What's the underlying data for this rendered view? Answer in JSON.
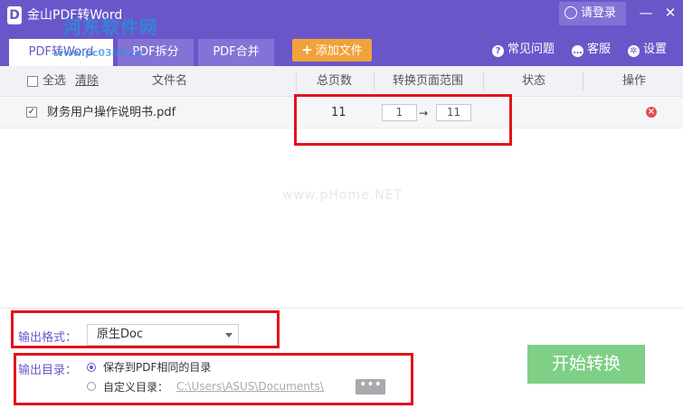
{
  "window": {
    "logo_letter": "D",
    "title": "金山PDF转Word",
    "login_label": "请登录",
    "minimize_glyph": "—",
    "close_glyph": "✕"
  },
  "watermark": {
    "brand": "河东软件网",
    "url": "www.pc0359.cn",
    "center": "www.pHome.NET"
  },
  "tabs": [
    {
      "label": "PDF转Word",
      "active": true
    },
    {
      "label": "PDF拆分",
      "active": false
    },
    {
      "label": "PDF合并",
      "active": false
    }
  ],
  "toolbar": {
    "add_file_label": "添加文件",
    "faq_label": "常见问题",
    "service_label": "客服",
    "settings_label": "设置"
  },
  "table": {
    "select_all_label": "全选",
    "clear_label": "清除",
    "columns": [
      "文件名",
      "总页数",
      "转换页面范围",
      "状态",
      "操作"
    ],
    "rows": [
      {
        "checked": true,
        "filename": "财务用户操作说明书.pdf",
        "total_pages": "11",
        "range_from": "1",
        "range_to": "11",
        "arrow": "→",
        "status": ""
      }
    ]
  },
  "output": {
    "format_label": "输出格式：",
    "format_value": "原生Doc",
    "dir_label": "输出目录：",
    "option_same": "保存到PDF相同的目录",
    "option_custom": "自定义目录：",
    "custom_path": "C:\\Users\\ASUS\\Documents\\",
    "more_glyph": "•••",
    "selected_option": "same"
  },
  "convert_label": "开始转换",
  "colors": {
    "titlebar": "#6b56c9",
    "accent_orange": "#f0a33a",
    "convert_green": "#7fcf86",
    "highlight_red": "#e0141e"
  }
}
